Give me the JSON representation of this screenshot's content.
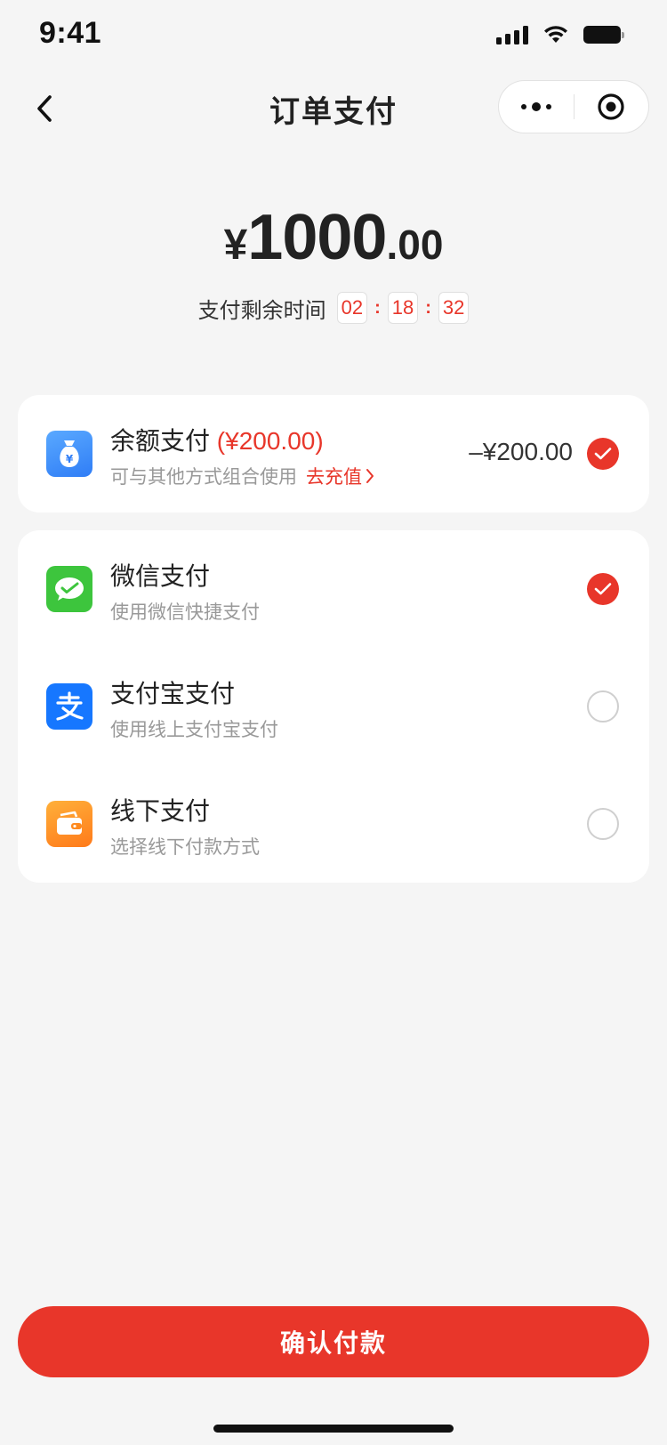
{
  "status_bar": {
    "time": "9:41"
  },
  "nav": {
    "title": "订单支付"
  },
  "amount": {
    "currency": "¥",
    "integer": "1000",
    "decimal": ".00"
  },
  "timer": {
    "label": "支付剩余时间",
    "hours": "02",
    "minutes": "18",
    "seconds": "32",
    "separator": ":"
  },
  "balance": {
    "title": "余额支付",
    "available": "(¥200.00)",
    "subtitle": "可与其他方式组合使用",
    "recharge_link": "去充值",
    "deduction": "–¥200.00",
    "selected": true,
    "icon": "money-bag-icon"
  },
  "methods": [
    {
      "title": "微信支付",
      "subtitle": "使用微信快捷支付",
      "selected": true,
      "icon": "wechat-pay-icon",
      "color": "#3dc53d"
    },
    {
      "title": "支付宝支付",
      "subtitle": "使用线上支付宝支付",
      "selected": false,
      "icon": "alipay-icon",
      "color": "#1677ff"
    },
    {
      "title": "线下支付",
      "subtitle": "选择线下付款方式",
      "selected": false,
      "icon": "wallet-icon",
      "color": "#ff8a1f"
    }
  ],
  "confirm": {
    "label": "确认付款"
  },
  "colors": {
    "accent": "#e8362a",
    "background": "#f5f5f5"
  }
}
